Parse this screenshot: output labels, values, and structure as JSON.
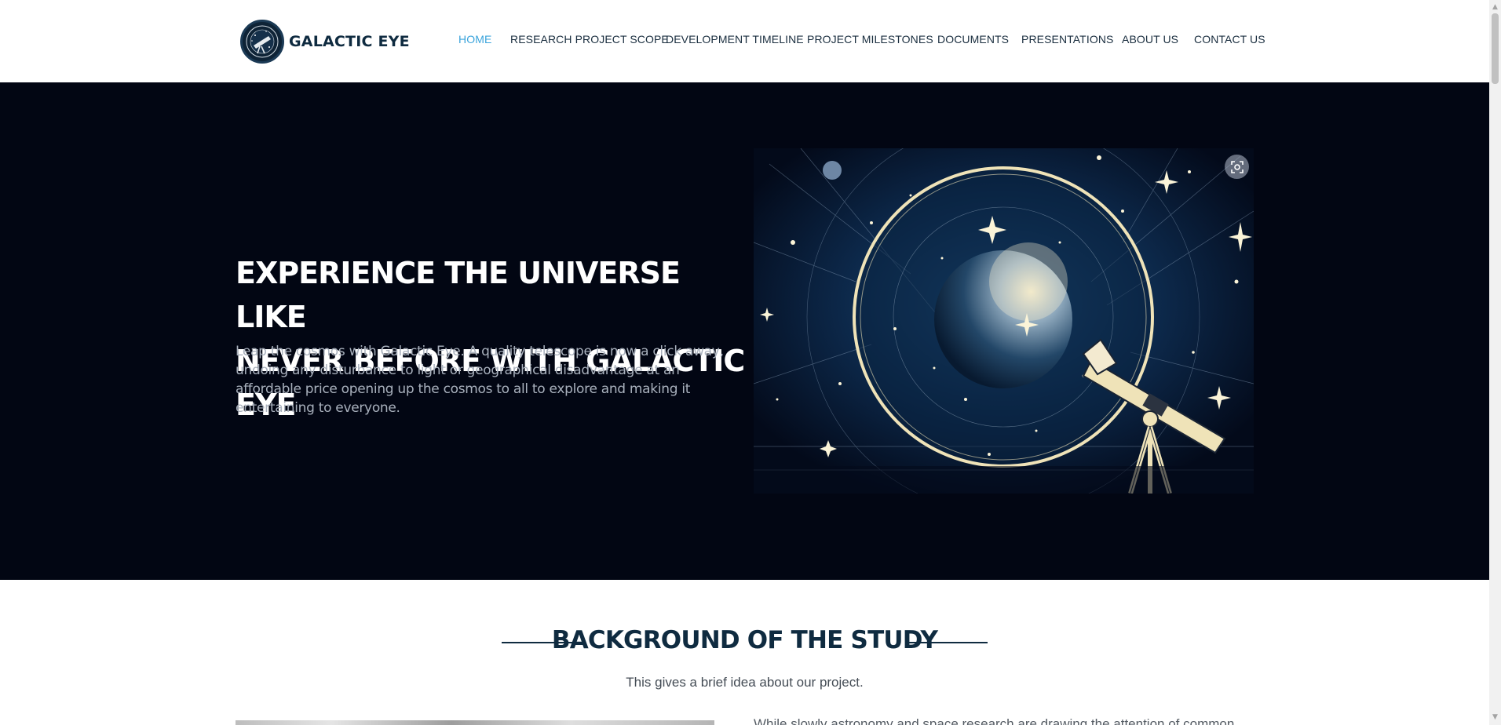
{
  "brand": {
    "name": "GALACTIC EYE",
    "logo_icon": "telescope-emblem-icon"
  },
  "nav": {
    "items": [
      {
        "label": "HOME",
        "active": true
      },
      {
        "label": "RESEARCH PROJECT SCOPE"
      },
      {
        "label": "DEVELOPMENT TIMELINE"
      },
      {
        "label": "PROJECT MILESTONES"
      },
      {
        "label": "DOCUMENTS"
      },
      {
        "label": "PRESENTATIONS"
      },
      {
        "label": "ABOUT US"
      },
      {
        "label": "CONTACT US"
      }
    ]
  },
  "hero": {
    "heading_line1": "EXPERIENCE THE UNIVERSE LIKE",
    "heading_line2": "NEVER BEFORE WITH GALACTIC EYE",
    "description": "Leap the cosmos with Galactic Eye. A quality telescope is now a click away, undoing any disturbance to light or geographical disadvantage at an affordable price opening up the cosmos to all to explore and making it entertaining to everyone.",
    "image_icon": "telescope-globe-illustration",
    "lens_icon": "visual-search-icon"
  },
  "background_section": {
    "title": "BACKGROUND OF THE STUDY",
    "subtitle": "This gives a brief idea about our project.",
    "body_text": "While slowly astronomy and space research are drawing the attention of common"
  },
  "colors": {
    "brand_dark": "#0f2b40",
    "nav_active": "#3aa4dc",
    "hero_bg": "#020613",
    "accent_gold": "#efe3b8"
  }
}
